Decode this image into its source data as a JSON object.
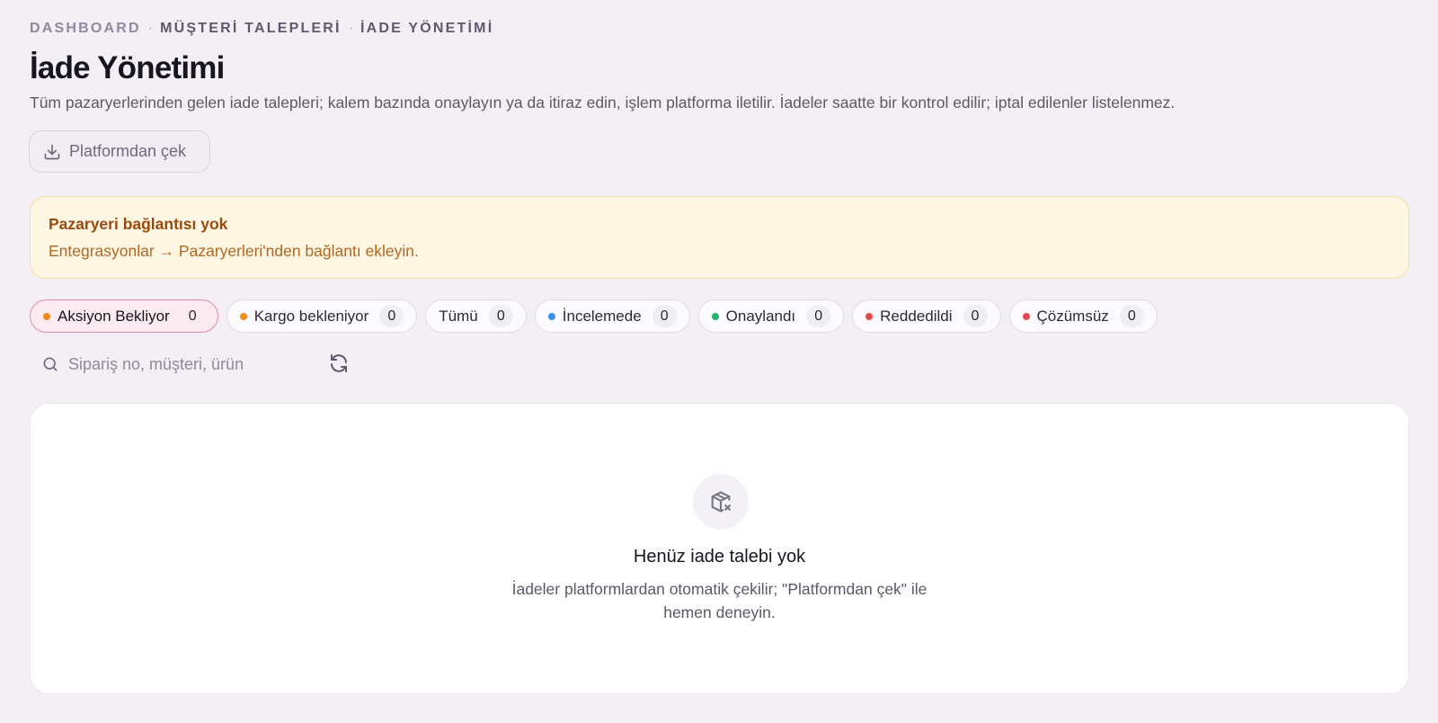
{
  "breadcrumb": {
    "items": [
      "DASHBOARD",
      "MÜŞTERİ TALEPLERİ",
      "İADE YÖNETİMİ"
    ],
    "separator": "·"
  },
  "page": {
    "title": "İade Yönetimi",
    "description": "Tüm pazaryerlerinden gelen iade talepleri; kalem bazında onaylayın ya da itiraz edin, işlem platforma iletilir. İadeler saatte bir kontrol edilir; iptal edilenler listelenmez."
  },
  "toolbar": {
    "pull_label": "Platformdan çek",
    "pull_icon": "download-icon"
  },
  "alert": {
    "title": "Pazaryeri bağlantısı yok",
    "text": "Entegrasyonlar → Pazaryerleri'nden bağlantı ekleyin."
  },
  "tabs": [
    {
      "label": "Aksiyon Bekliyor",
      "count": "0",
      "dot": "#f28a1b",
      "active": true
    },
    {
      "label": "Kargo bekleniyor",
      "count": "0",
      "dot": "#f28a1b",
      "active": false
    },
    {
      "label": "Tümü",
      "count": "0",
      "dot": null,
      "active": false
    },
    {
      "label": "İncelemede",
      "count": "0",
      "dot": "#3b8ff0",
      "active": false
    },
    {
      "label": "Onaylandı",
      "count": "0",
      "dot": "#1fb36b",
      "active": false
    },
    {
      "label": "Reddedildi",
      "count": "0",
      "dot": "#e5484d",
      "active": false
    },
    {
      "label": "Çözümsüz",
      "count": "0",
      "dot": "#e5484d",
      "active": false
    }
  ],
  "search": {
    "placeholder": "Sipariş no, müşteri, ürün",
    "value": ""
  },
  "empty": {
    "icon": "package-x-icon",
    "title": "Henüz iade talebi yok",
    "text": "İadeler platformlardan otomatik çekilir; \"Platformdan çek\" ile hemen deneyin."
  }
}
